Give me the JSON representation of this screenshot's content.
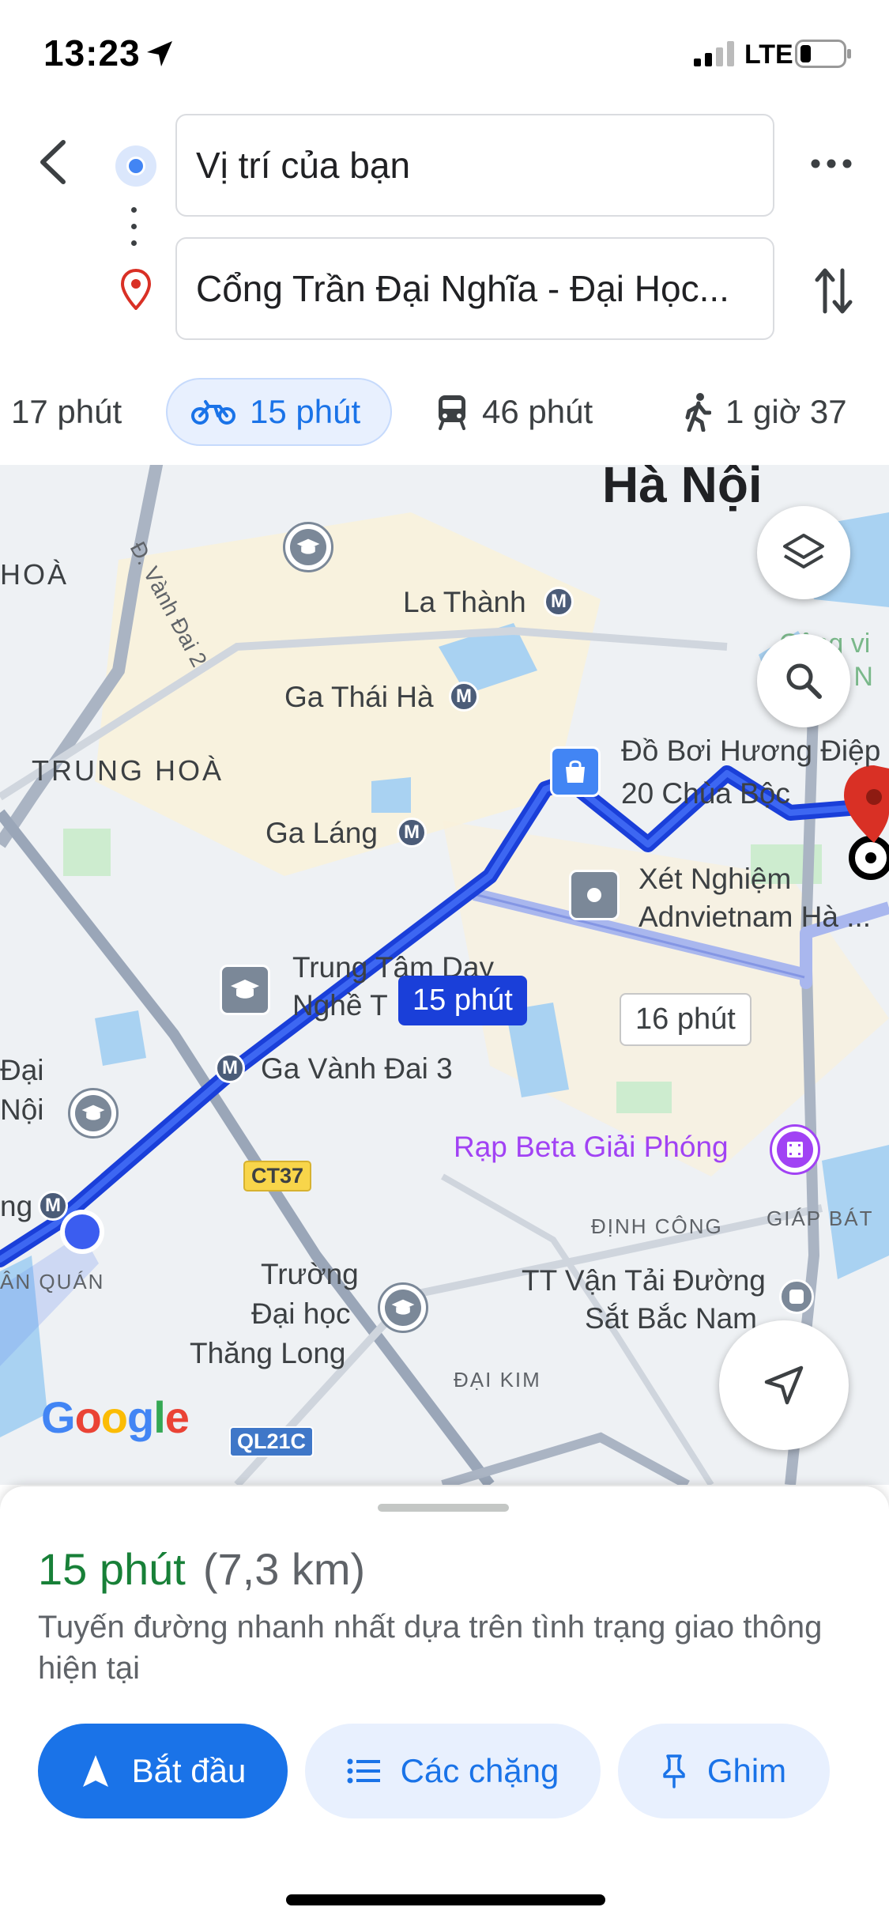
{
  "status_bar": {
    "time": "13:23",
    "network": "LTE"
  },
  "directions": {
    "origin": "Vị trí của bạn",
    "destination": "Cổng Trần Đại Nghĩa - Đại Học..."
  },
  "modes": [
    {
      "icon": "car-icon",
      "label": "17 phút"
    },
    {
      "icon": "motorbike-icon",
      "label": "15 phút",
      "selected": true
    },
    {
      "icon": "transit-icon",
      "label": "46 phút"
    },
    {
      "icon": "walk-icon",
      "label": "1 giờ 37"
    }
  ],
  "map": {
    "city": "Hà Nội",
    "districts": [
      "HOÀ",
      "TRUNG HOÀ",
      "ĐỊNH CÔNG",
      "GIÁP BÁT",
      "ĐẠI KIM",
      "ÂN QUÁN"
    ],
    "road": "Đ. Vành Đai 2",
    "metro_stations": [
      "La Thành",
      "Ga Thái Hà",
      "Ga Láng",
      "Ga Vành Đai 3"
    ],
    "pois": {
      "shop": [
        "Đồ Bơi Hương Điệp",
        "20 Chùa Bộc"
      ],
      "lab": [
        "Xét Nghiệm",
        "Adnvietnam Hà ..."
      ],
      "school_center": [
        "Trung Tâm Dạy",
        "Nghề T"
      ],
      "cinema": "Rạp Beta Giải Phóng",
      "transport": [
        "TT Vận Tải Đường",
        "Sắt Bắc Nam"
      ],
      "university": [
        "Trường",
        "Đại học",
        "Thăng Long"
      ],
      "partial_left": [
        "Đại",
        "Nội"
      ],
      "partial_edge": "ng",
      "partial_top_right": [
        "Công vi",
        "g N"
      ]
    },
    "shields": [
      "CT37",
      "QL21C"
    ],
    "route_primary_label": "15 phút",
    "route_alt_label": "16 phút",
    "attribution": "Google",
    "colors": {
      "route": "#1a3fd9",
      "route_alt": "#a9b7ee",
      "destination_pin": "#d93025"
    }
  },
  "sheet": {
    "duration": "15 phút",
    "distance": "(7,3 km)",
    "description": "Tuyến đường nhanh nhất dựa trên tình trạng giao thông hiện tại",
    "buttons": {
      "start": "Bắt đầu",
      "steps": "Các chặng",
      "pin": "Ghim"
    }
  }
}
